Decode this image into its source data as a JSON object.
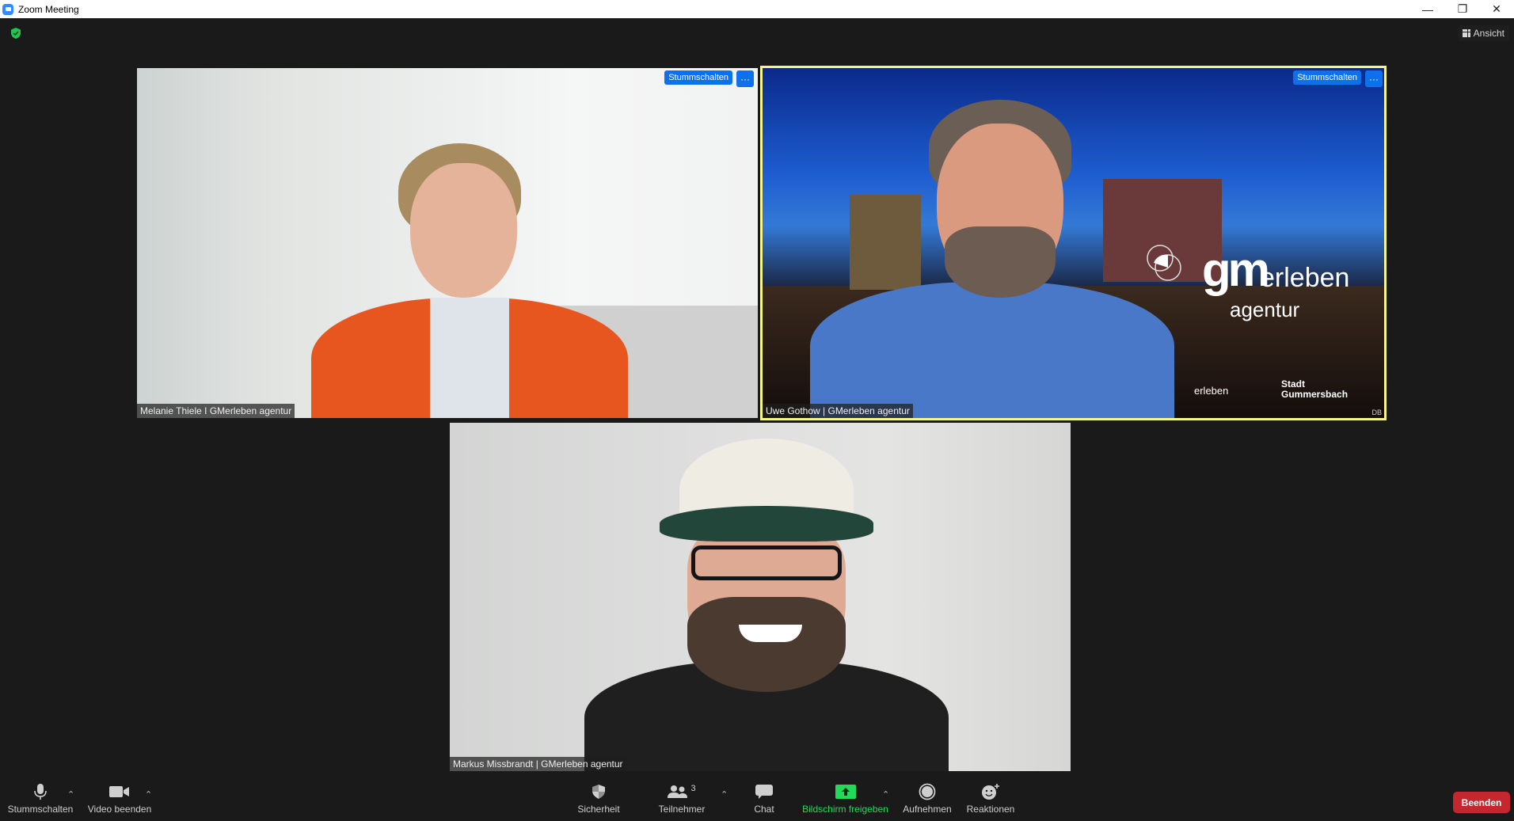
{
  "window": {
    "title": "Zoom Meeting",
    "controls": {
      "minimize": "—",
      "restore": "❐",
      "close": "✕"
    }
  },
  "top_bar": {
    "security_status_icon": "shield-check-icon",
    "view_button_label": "Ansicht"
  },
  "colors": {
    "accent_blue": "#0e71eb",
    "active_speaker_border": "#f5f58a",
    "share_green": "#23d959",
    "end_red": "#c6262e",
    "background": "#1a1a1a"
  },
  "participants": [
    {
      "name": "Melanie Thiele I GMerleben agentur",
      "mute_label": "Stummschalten",
      "more_label": "···",
      "active_speaker": false
    },
    {
      "name": "Uwe Gothow | GMerleben agentur",
      "mute_label": "Stummschalten",
      "more_label": "···",
      "active_speaker": true,
      "background_logo": {
        "gm": "gm",
        "erleben": "erleben",
        "agentur": "agentur",
        "small_logo": "erleben",
        "city": "Stadt",
        "city2": "Gummersbach",
        "watermark": "DB"
      }
    },
    {
      "name": "Markus Missbrandt | GMerleben agentur",
      "active_speaker": false
    }
  ],
  "toolbar": {
    "mute": {
      "label": "Stummschalten",
      "icon": "microphone-icon"
    },
    "video": {
      "label": "Video beenden",
      "icon": "video-camera-icon"
    },
    "security": {
      "label": "Sicherheit",
      "icon": "shield-icon"
    },
    "participants": {
      "label": "Teilnehmer",
      "count": "3",
      "icon": "participants-icon"
    },
    "chat": {
      "label": "Chat",
      "icon": "chat-bubble-icon"
    },
    "share": {
      "label": "Bildschirm freigeben",
      "icon": "share-screen-icon"
    },
    "record": {
      "label": "Aufnehmen",
      "icon": "record-icon"
    },
    "reactions": {
      "label": "Reaktionen",
      "icon": "reaction-emoji-icon"
    },
    "caret": "⌃",
    "end": {
      "label": "Beenden"
    }
  }
}
